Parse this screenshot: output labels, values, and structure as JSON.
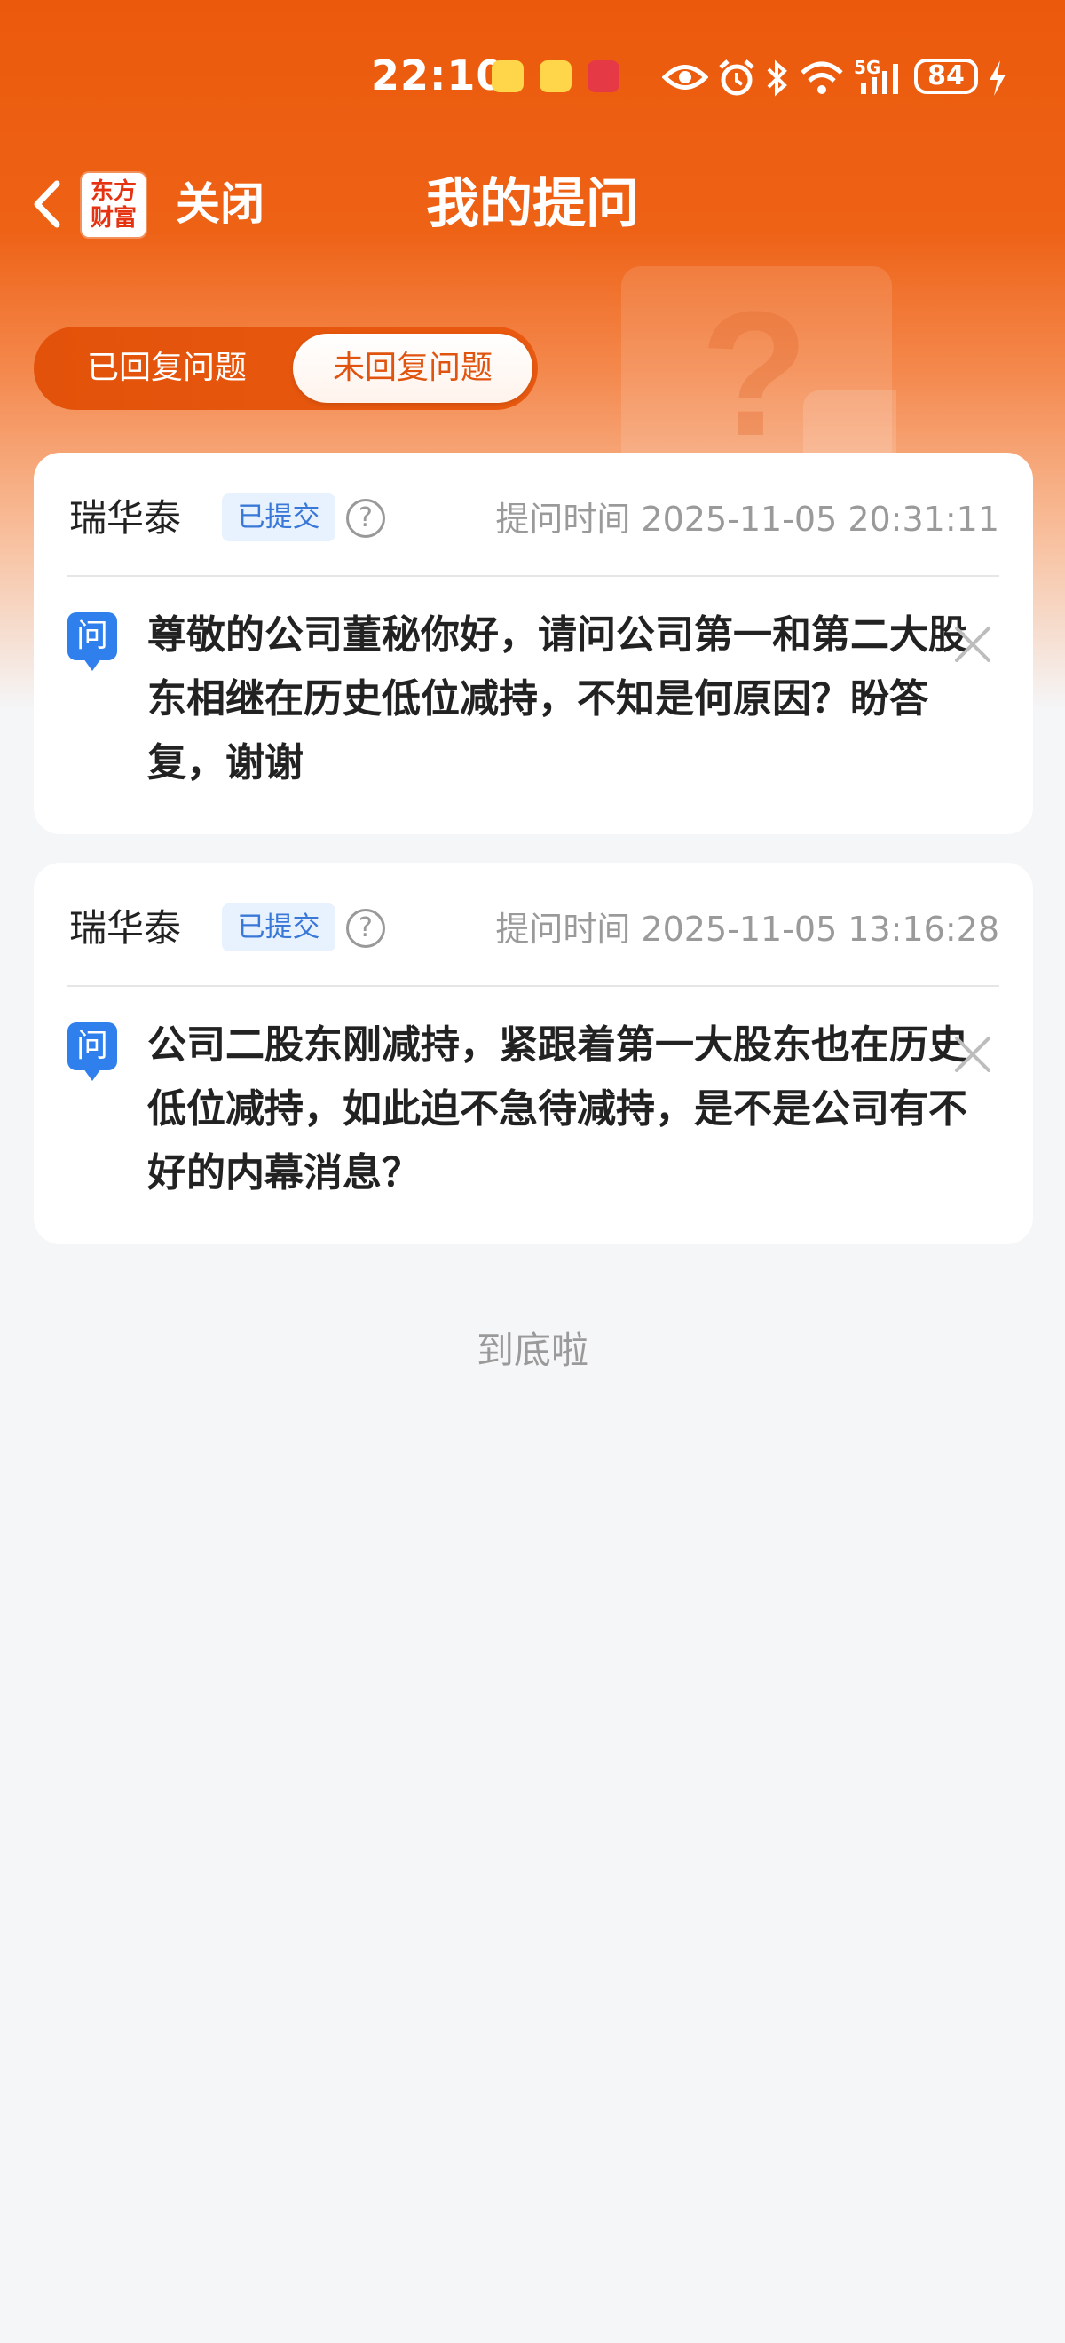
{
  "status_bar": {
    "time": "22:10",
    "battery": "84",
    "network_label": "5G"
  },
  "nav": {
    "logo_line1": "东方",
    "logo_line2": "财富",
    "close_label": "关闭",
    "title": "我的提问"
  },
  "tabs": {
    "answered": "已回复问题",
    "unanswered": "未回复问题"
  },
  "questions": [
    {
      "company": "瑞华泰",
      "status": "已提交",
      "time": "提问时间 2025-11-05 20:31:11",
      "q_icon": "问",
      "text": "尊敬的公司董秘你好，请问公司第一和第二大股东相继在历史低位减持，不知是何原因？盼答复，谢谢"
    },
    {
      "company": "瑞华泰",
      "status": "已提交",
      "time": "提问时间 2025-11-05 13:16:28",
      "q_icon": "问",
      "text": "公司二股东刚减持，紧跟着第一大股东也在历史低位减持，如此迫不急待减持，是不是公司有不好的内幕消息？"
    }
  ],
  "footer": {
    "end_text": "到底啦"
  },
  "colors": {
    "brand_orange": "#EB5A0C",
    "badge_blue": "#3A78D8",
    "question_icon_blue": "#2F80ED"
  }
}
